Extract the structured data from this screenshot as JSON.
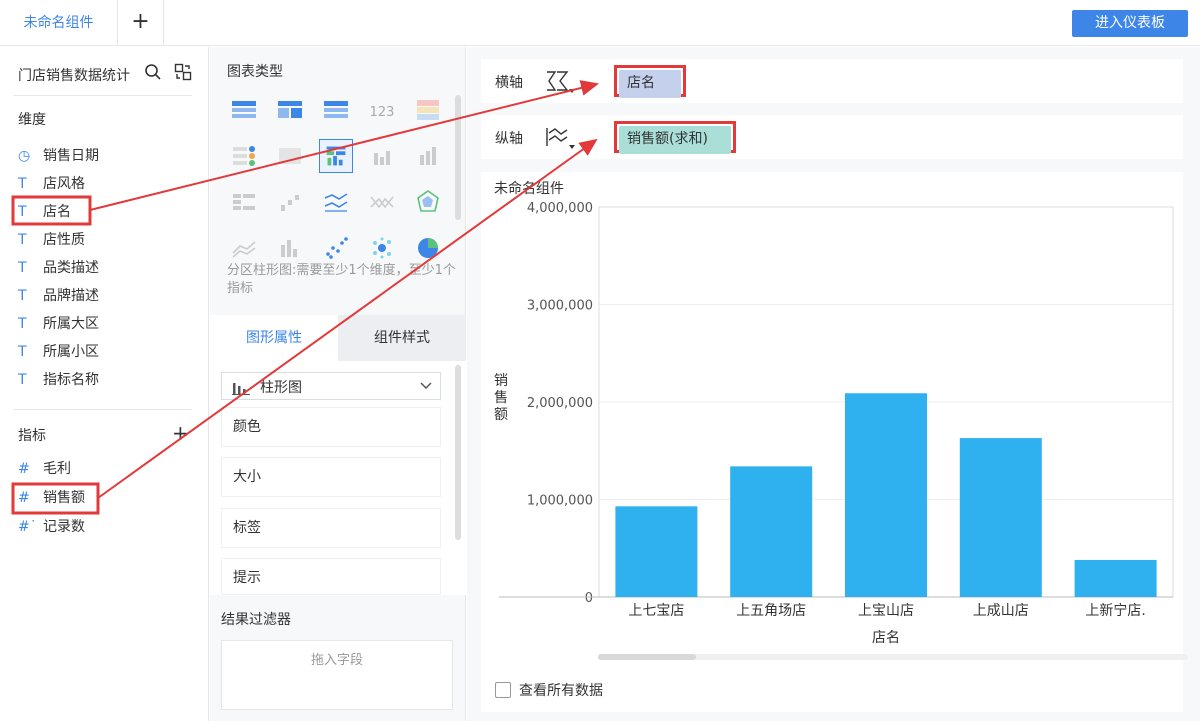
{
  "topbar": {
    "tab_label": "未命名组件",
    "add_tab": "+",
    "enter_dashboard": "进入仪表板"
  },
  "data_panel": {
    "dataset_title": "门店销售数据统计",
    "dimensions_title": "维度",
    "dimensions": [
      {
        "icon": "clock-icon",
        "glyph": "◷",
        "label": "销售日期"
      },
      {
        "icon": "text-type-icon",
        "glyph": "T",
        "label": "店风格"
      },
      {
        "icon": "text-type-icon",
        "glyph": "T",
        "label": "店名"
      },
      {
        "icon": "text-type-icon",
        "glyph": "T",
        "label": "店性质"
      },
      {
        "icon": "text-type-icon",
        "glyph": "T",
        "label": "品类描述"
      },
      {
        "icon": "text-type-icon",
        "glyph": "T",
        "label": "品牌描述"
      },
      {
        "icon": "text-type-icon",
        "glyph": "T",
        "label": "所属大区"
      },
      {
        "icon": "text-type-icon",
        "glyph": "T",
        "label": "所属小区"
      },
      {
        "icon": "text-type-icon",
        "glyph": "T",
        "label": "指标名称"
      }
    ],
    "metrics_title": "指标",
    "add_metric": "+",
    "metrics": [
      {
        "icon": "number-type-icon",
        "glyph": "#",
        "label": "毛利"
      },
      {
        "icon": "number-type-icon",
        "glyph": "#",
        "label": "销售额"
      },
      {
        "icon": "record-count-icon",
        "glyph": "#˙",
        "label": "记录数"
      }
    ]
  },
  "chart_type_panel": {
    "title": "图表类型",
    "hint": "分区柱形图:需要至少1个维度，至少1个指标",
    "tabs": [
      "图形属性",
      "组件样式"
    ],
    "chart_select": "柱形图",
    "properties": [
      "颜色",
      "大小",
      "标签",
      "提示"
    ],
    "filter_title": "结果过滤器",
    "filter_placeholder": "拖入字段"
  },
  "axes": {
    "x_label": "横轴",
    "x_field": "店名",
    "y_label": "纵轴",
    "y_field": "销售额(求和)"
  },
  "widget": {
    "title": "未命名组件",
    "show_all_data": "查看所有数据"
  },
  "colors": {
    "accent": "#3d86e8",
    "bar": "#2fb1ef",
    "highlight": "#e23a3a",
    "x_pill": "#c5d0ec",
    "y_pill": "#a9dfd7"
  },
  "chart_data": {
    "type": "bar",
    "categories": [
      "上七宝店",
      "上五角场店",
      "上宝山店",
      "上成山店",
      "上新宁店."
    ],
    "values": [
      930000,
      1340000,
      2090000,
      1630000,
      380000
    ],
    "xlabel": "店名",
    "ylabel": "销售额",
    "ylim": [
      0,
      4000000
    ],
    "yticks": [
      "4,000,000",
      "3,000,000",
      "2,000,000",
      "1,000,000",
      "0"
    ],
    "grid": true
  }
}
